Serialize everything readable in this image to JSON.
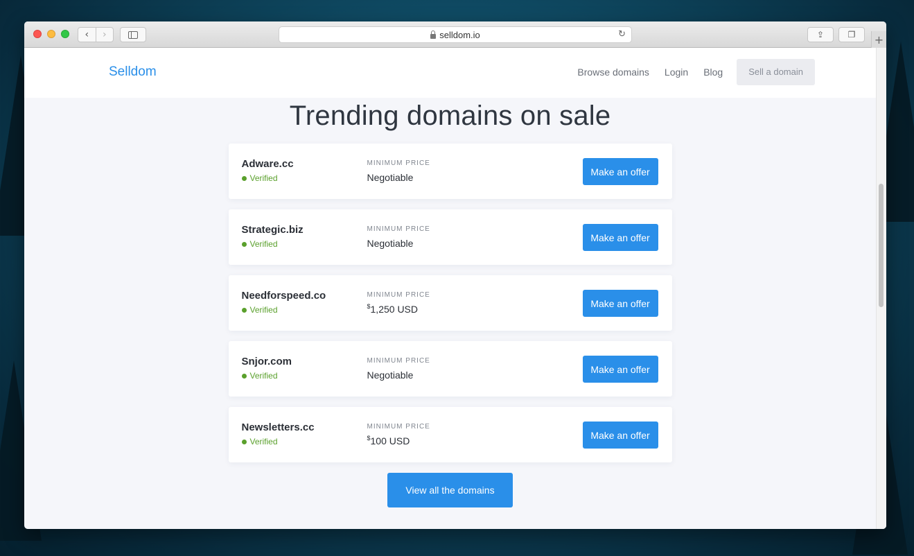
{
  "browser": {
    "url": "selldom.io",
    "nav_back": "‹",
    "nav_forward": "›",
    "reload_icon": "reload-icon",
    "share_icon": "share-icon",
    "tabs_icon": "tabs-icon",
    "new_tab": "+"
  },
  "header": {
    "logo": "Selldom",
    "nav": [
      {
        "label": "Browse domains"
      },
      {
        "label": "Login"
      },
      {
        "label": "Blog"
      },
      {
        "label": "Sell a domain"
      }
    ]
  },
  "main": {
    "title": "Trending domains on sale",
    "domains": [
      {
        "name": "Adware.cc",
        "status": "Verified",
        "price_label": "MINIMUM PRICE",
        "price_currency": "",
        "price": "Negotiable",
        "action": "Make an offer"
      },
      {
        "name": "Strategic.biz",
        "status": "Verified",
        "price_label": "MINIMUM PRICE",
        "price_currency": "",
        "price": "Negotiable",
        "action": "Make an offer"
      },
      {
        "name": "Needforspeed.co",
        "status": "Verified",
        "price_label": "MINIMUM PRICE",
        "price_currency": "$",
        "price": "1,250 USD",
        "action": "Make an offer"
      },
      {
        "name": "Snjor.com",
        "status": "Verified",
        "price_label": "MINIMUM PRICE",
        "price_currency": "",
        "price": "Negotiable",
        "action": "Make an offer"
      },
      {
        "name": "Newsletters.cc",
        "status": "Verified",
        "price_label": "MINIMUM PRICE",
        "price_currency": "$",
        "price": "100 USD",
        "action": "Make an offer"
      }
    ],
    "view_all": "View all the domains"
  },
  "colors": {
    "accent": "#2a8fe9",
    "verified": "#5aa02c",
    "page_bg": "#f5f6fa"
  }
}
